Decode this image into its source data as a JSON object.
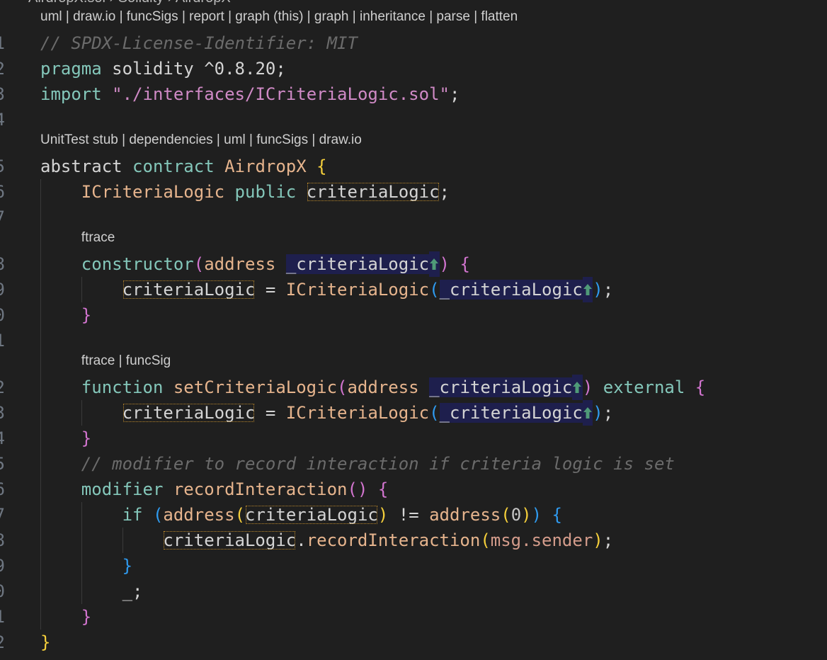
{
  "breadcrumb": "AirdropX.sol › Solidity › AirdropX",
  "colors": {
    "background": "#1f1f1f",
    "keyword": "#84c7ba",
    "type": "#e6b48d",
    "string": "#d08ac6",
    "comment": "#6b6b6b",
    "bracket_1": "#f5cf3b",
    "bracket_2": "#d375d0",
    "bracket_3": "#2f9bf0"
  },
  "rows": [
    {
      "kind": "lens",
      "text": "uml | draw.io | funcSigs | report | graph (this) | graph | inheritance | parse | flatten"
    },
    {
      "kind": "code",
      "n": "1",
      "g": 0,
      "tokens": [
        [
          "// SPDX-License-Identifier: MIT",
          "cmt"
        ]
      ]
    },
    {
      "kind": "code",
      "n": "2",
      "g": 0,
      "tokens": [
        [
          "pragma",
          "kw"
        ],
        [
          " solidity ^0.8.20;",
          ""
        ]
      ]
    },
    {
      "kind": "code",
      "n": "3",
      "g": 0,
      "tokens": [
        [
          "import",
          "kw"
        ],
        [
          " ",
          ""
        ],
        [
          "\"./interfaces/ICriteriaLogic.sol\"",
          "str"
        ],
        [
          ";",
          ""
        ]
      ]
    },
    {
      "kind": "code",
      "n": "4",
      "g": 0,
      "tokens": []
    },
    {
      "kind": "lens",
      "text": "UnitTest stub | dependencies | uml | funcSigs | draw.io"
    },
    {
      "kind": "code",
      "n": "5",
      "g": 0,
      "tokens": [
        [
          "abstract ",
          ""
        ],
        [
          "contract",
          "kw"
        ],
        [
          " ",
          ""
        ],
        [
          "AirdropX",
          "ty"
        ],
        [
          " ",
          ""
        ],
        [
          "{",
          "b0"
        ]
      ]
    },
    {
      "kind": "code",
      "n": "6",
      "g": 1,
      "tokens": [
        [
          "    ",
          ""
        ],
        [
          "ICriteriaLogic",
          "ty"
        ],
        [
          " ",
          ""
        ],
        [
          "public",
          "kw"
        ],
        [
          " ",
          ""
        ],
        [
          "criteriaLogic",
          "box"
        ],
        [
          ";",
          ""
        ]
      ]
    },
    {
      "kind": "code",
      "n": "7",
      "g": 1,
      "tokens": []
    },
    {
      "kind": "lens",
      "g": 1,
      "indent": "    ",
      "text": "ftrace"
    },
    {
      "kind": "code",
      "n": "8",
      "g": 1,
      "tokens": [
        [
          "    ",
          ""
        ],
        [
          "constructor",
          "kw"
        ],
        [
          "(",
          "b1"
        ],
        [
          "address",
          "ty"
        ],
        [
          " ",
          ""
        ],
        [
          "_criteriaLogic",
          "hl"
        ],
        [
          "arrow-up-icon",
          "icon"
        ],
        [
          ")",
          "b1"
        ],
        [
          " ",
          ""
        ],
        [
          "{",
          "b1"
        ]
      ]
    },
    {
      "kind": "code",
      "n": "9",
      "g": 2,
      "tokens": [
        [
          "        ",
          ""
        ],
        [
          "criteriaLogic",
          "box"
        ],
        [
          " = ",
          ""
        ],
        [
          "ICriteriaLogic",
          "ty"
        ],
        [
          "(",
          "b2"
        ],
        [
          "_criteriaLogic",
          "hl"
        ],
        [
          "arrow-up-icon",
          "icon"
        ],
        [
          ")",
          "b2"
        ],
        [
          ";",
          ""
        ]
      ]
    },
    {
      "kind": "code",
      "n": "10",
      "g": 1,
      "tokens": [
        [
          "    ",
          ""
        ],
        [
          "}",
          "b1"
        ]
      ]
    },
    {
      "kind": "code",
      "n": "11",
      "g": 1,
      "tokens": []
    },
    {
      "kind": "lens",
      "g": 1,
      "indent": "    ",
      "text": "ftrace | funcSig"
    },
    {
      "kind": "code",
      "n": "12",
      "g": 1,
      "tokens": [
        [
          "    ",
          ""
        ],
        [
          "function",
          "kw"
        ],
        [
          " ",
          ""
        ],
        [
          "setCriteriaLogic",
          "fn"
        ],
        [
          "(",
          "b1"
        ],
        [
          "address",
          "ty"
        ],
        [
          " ",
          ""
        ],
        [
          "_criteriaLogic",
          "hl"
        ],
        [
          "arrow-up-icon",
          "icon"
        ],
        [
          ")",
          "b1"
        ],
        [
          " ",
          ""
        ],
        [
          "external",
          "kw"
        ],
        [
          " ",
          ""
        ],
        [
          "{",
          "b1"
        ]
      ]
    },
    {
      "kind": "code",
      "n": "13",
      "g": 2,
      "tokens": [
        [
          "        ",
          ""
        ],
        [
          "criteriaLogic",
          "box"
        ],
        [
          " = ",
          ""
        ],
        [
          "ICriteriaLogic",
          "ty"
        ],
        [
          "(",
          "b2"
        ],
        [
          "_criteriaLogic",
          "hl"
        ],
        [
          "arrow-up-icon",
          "icon"
        ],
        [
          ")",
          "b2"
        ],
        [
          ";",
          ""
        ]
      ]
    },
    {
      "kind": "code",
      "n": "14",
      "g": 1,
      "tokens": [
        [
          "    ",
          ""
        ],
        [
          "}",
          "b1"
        ]
      ]
    },
    {
      "kind": "code",
      "n": "15",
      "g": 1,
      "tokens": [
        [
          "    ",
          ""
        ],
        [
          "// modifier to record interaction if criteria logic is set",
          "cmt"
        ]
      ]
    },
    {
      "kind": "code",
      "n": "16",
      "g": 1,
      "tokens": [
        [
          "    ",
          ""
        ],
        [
          "modifier",
          "kw"
        ],
        [
          " ",
          ""
        ],
        [
          "recordInteraction",
          "fn"
        ],
        [
          "(",
          "b1"
        ],
        [
          ")",
          "b1"
        ],
        [
          " ",
          ""
        ],
        [
          "{",
          "b1"
        ]
      ]
    },
    {
      "kind": "code",
      "n": "17",
      "g": 2,
      "tokens": [
        [
          "        ",
          ""
        ],
        [
          "if",
          "kw"
        ],
        [
          " ",
          ""
        ],
        [
          "(",
          "b2"
        ],
        [
          "address",
          "ty"
        ],
        [
          "(",
          "b0"
        ],
        [
          "criteriaLogic",
          "box"
        ],
        [
          ")",
          "b0"
        ],
        [
          " != ",
          ""
        ],
        [
          "address",
          "ty"
        ],
        [
          "(",
          "b0"
        ],
        [
          "0",
          "num"
        ],
        [
          ")",
          "b0"
        ],
        [
          ")",
          "b2"
        ],
        [
          " ",
          ""
        ],
        [
          "{",
          "b2"
        ]
      ]
    },
    {
      "kind": "code",
      "n": "18",
      "g": 3,
      "tokens": [
        [
          "            ",
          ""
        ],
        [
          "criteriaLogic",
          "box"
        ],
        [
          ".",
          ""
        ],
        [
          "recordInteraction",
          "fn"
        ],
        [
          "(",
          "b0"
        ],
        [
          "msg.sender",
          "msg"
        ],
        [
          ")",
          "b0"
        ],
        [
          ";",
          ""
        ]
      ]
    },
    {
      "kind": "code",
      "n": "19",
      "g": 2,
      "tokens": [
        [
          "        ",
          ""
        ],
        [
          "}",
          "b2"
        ]
      ]
    },
    {
      "kind": "code",
      "n": "20",
      "g": 2,
      "tokens": [
        [
          "        _;",
          ""
        ]
      ]
    },
    {
      "kind": "code",
      "n": "21",
      "g": 1,
      "tokens": [
        [
          "    ",
          ""
        ],
        [
          "}",
          "b1"
        ]
      ]
    },
    {
      "kind": "code",
      "n": "22",
      "g": 0,
      "tokens": [
        [
          "}",
          "b0"
        ]
      ]
    }
  ]
}
